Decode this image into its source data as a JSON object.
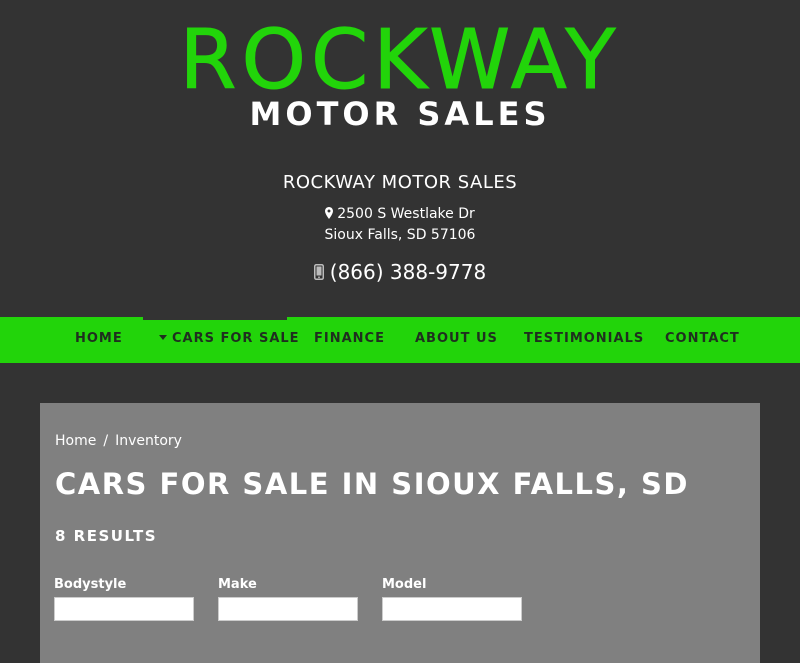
{
  "brand": {
    "logo_main": "ROCKWAY",
    "logo_sub": "MOTOR SALES",
    "logo_color": "#22d40a"
  },
  "dealer": {
    "name": "ROCKWAY MOTOR SALES",
    "address_line1": "2500 S Westlake Dr",
    "address_line2": "Sioux Falls, SD 57106",
    "phone": "(866) 388-9778",
    "address_icon": "map-pin-icon",
    "phone_icon": "mobile-phone-icon"
  },
  "nav": {
    "background_color": "#22d40a",
    "active": "CARS FOR SALE",
    "items": [
      {
        "label": "HOME"
      },
      {
        "label": "CARS FOR SALE",
        "has_dropdown": true
      },
      {
        "label": "FINANCE"
      },
      {
        "label": "ABOUT US"
      },
      {
        "label": "TESTIMONIALS"
      },
      {
        "label": "CONTACT"
      }
    ]
  },
  "breadcrumb": {
    "items": [
      "Home",
      "Inventory"
    ],
    "separator": "/"
  },
  "main": {
    "title": "CARS FOR SALE IN SIOUX FALLS, SD",
    "results": "8 RESULTS"
  },
  "filters": [
    {
      "label": "Bodystyle"
    },
    {
      "label": "Make"
    },
    {
      "label": "Model"
    }
  ]
}
